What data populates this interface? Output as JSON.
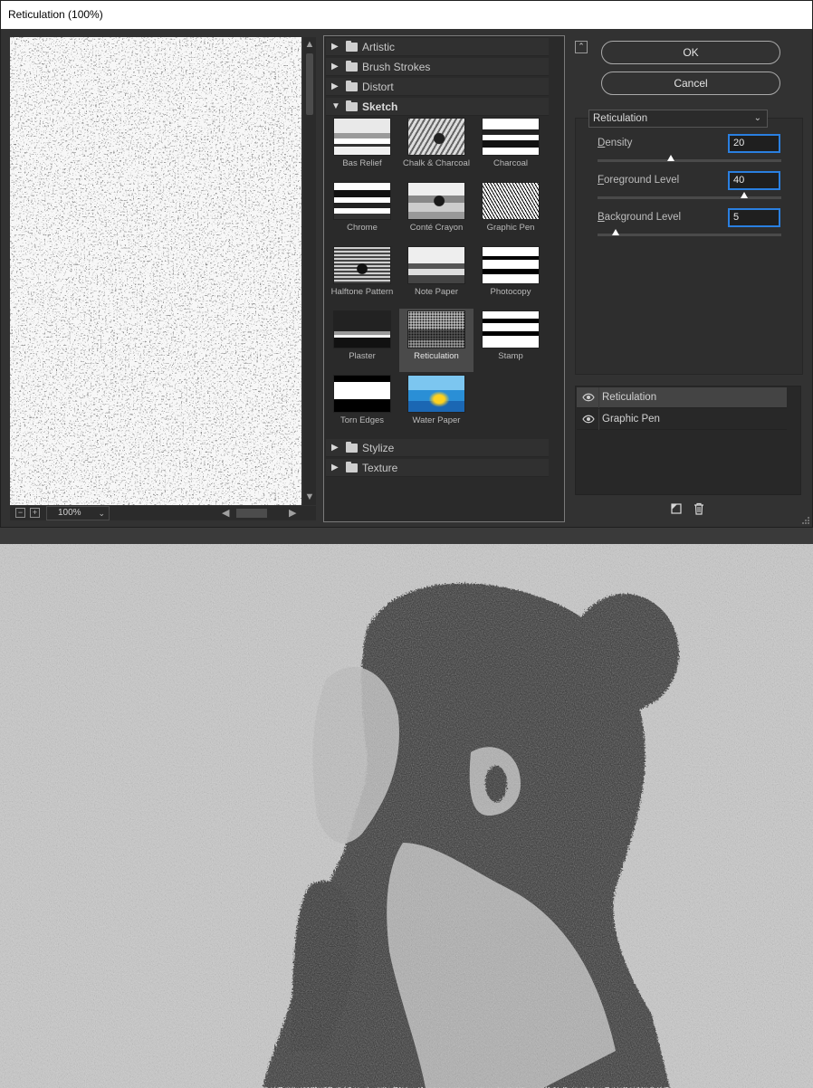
{
  "window": {
    "title": "Reticulation (100%)"
  },
  "preview": {
    "zoom_value": "100%",
    "zoom_out_symbol": "−",
    "zoom_in_symbol": "+"
  },
  "gallery": {
    "folders_top": [
      {
        "label": "Artistic",
        "open": false
      },
      {
        "label": "Brush Strokes",
        "open": false
      },
      {
        "label": "Distort",
        "open": false
      },
      {
        "label": "Sketch",
        "open": true
      }
    ],
    "filters": [
      {
        "label": "Bas Relief"
      },
      {
        "label": "Chalk & Charcoal"
      },
      {
        "label": "Charcoal"
      },
      {
        "label": "Chrome"
      },
      {
        "label": "Conté Crayon"
      },
      {
        "label": "Graphic Pen"
      },
      {
        "label": "Halftone Pattern"
      },
      {
        "label": "Note Paper"
      },
      {
        "label": "Photocopy"
      },
      {
        "label": "Plaster"
      },
      {
        "label": "Reticulation",
        "selected": true
      },
      {
        "label": "Stamp"
      },
      {
        "label": "Torn Edges"
      },
      {
        "label": "Water Paper"
      }
    ],
    "folders_bottom": [
      {
        "label": "Stylize",
        "open": false
      },
      {
        "label": "Texture",
        "open": false
      }
    ]
  },
  "buttons": {
    "ok": "OK",
    "cancel": "Cancel"
  },
  "settings": {
    "filter_select": "Reticulation",
    "params": [
      {
        "label": "Density",
        "accel": "D",
        "rest": "ensity",
        "value": "20",
        "slider_fraction": 0.4
      },
      {
        "label": "Foreground Level",
        "accel": "F",
        "rest": "oreground Level",
        "value": "40",
        "slider_fraction": 0.8
      },
      {
        "label": "Background Level",
        "accel": "B",
        "rest": "ackground Level",
        "value": "5",
        "slider_fraction": 0.1
      }
    ]
  },
  "layers": [
    {
      "label": "Reticulation",
      "selected": true
    },
    {
      "label": "Graphic Pen",
      "selected": false
    }
  ],
  "icons": {
    "collapse": "collapse-icon",
    "new_layer": "new-effect-layer-icon",
    "delete": "trash-icon",
    "eye": "eye-icon",
    "folder": "folder-icon"
  }
}
